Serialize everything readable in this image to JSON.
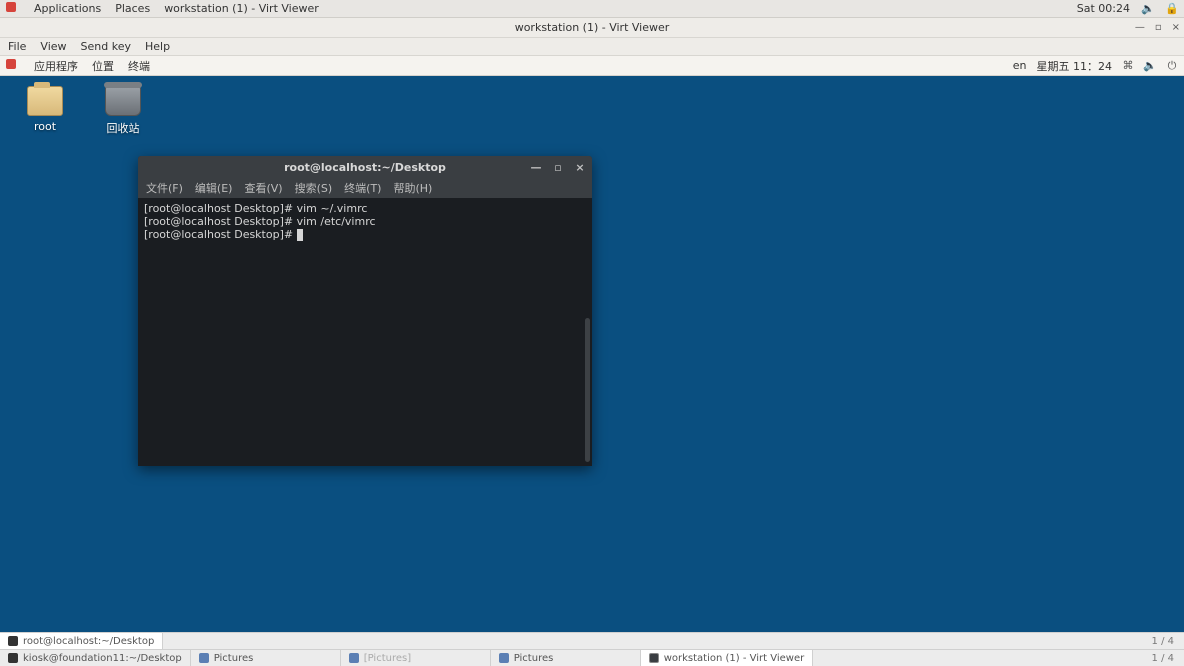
{
  "host_topbar": {
    "applications": "Applications",
    "places": "Places",
    "current_app": "workstation (1) - Virt Viewer",
    "clock": "Sat 00:24"
  },
  "viewer_window": {
    "title": "workstation (1) - Virt Viewer",
    "menus": {
      "file": "File",
      "view": "View",
      "sendkey": "Send key",
      "help": "Help"
    },
    "btn_min": "—",
    "btn_max": "▫",
    "btn_close": "×"
  },
  "vm_panel": {
    "apps": "应用程序",
    "places": "位置",
    "terminal": "终端",
    "lang": "en",
    "clock": "星期五 11：24"
  },
  "desktop": {
    "root_label": "root",
    "trash_label": "回收站"
  },
  "terminal": {
    "title": "root@localhost:~/Desktop",
    "menus": {
      "file": "文件(F)",
      "edit": "编辑(E)",
      "view": "查看(V)",
      "search": "搜索(S)",
      "term": "终端(T)",
      "help": "帮助(H)"
    },
    "lines": {
      "p1": "[root@localhost Desktop]# ",
      "c1": "vim ~/.vimrc",
      "p2": "[root@localhost Desktop]# ",
      "c2": "vim /etc/vimrc",
      "p3": "[root@localhost Desktop]# "
    },
    "btn_min": "—",
    "btn_max": "▫",
    "btn_close": "×"
  },
  "task_row1": {
    "task1": "root@localhost:~/Desktop",
    "page": "1 / 4"
  },
  "task_row2": {
    "t1": "kiosk@foundation11:~/Desktop",
    "t2": "Pictures",
    "t3": "[Pictures]",
    "t4": "Pictures",
    "t5": "workstation (1) - Virt Viewer",
    "page": "1 / 4"
  }
}
